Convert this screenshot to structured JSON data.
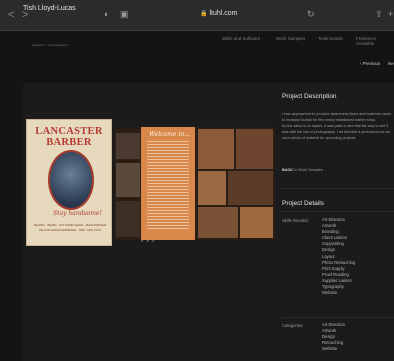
{
  "browser": {
    "back": "<",
    "forward": ">",
    "url": "ltuhl.com",
    "icons": [
      "chevron-left-icon",
      "chevron-right-icon",
      "privacy-icon",
      "tabs-icon",
      "reload-icon",
      "share-icon",
      "plus-icon"
    ]
  },
  "site": {
    "logo": "Tish Lloyd-Lucas",
    "logo_sub": "designer / photographer",
    "nav": [
      "Skills and Software",
      "Work Samples",
      "Testimonials",
      "Freelance Available"
    ]
  },
  "pager": {
    "previous": "‹ Previous",
    "next": "Ne"
  },
  "brochure": {
    "title_line1": "LANCASTER",
    "title_line2": "BARBER",
    "script": "Stay handsome!",
    "tagline_1": "SHAVING · BEARD · HOT TOWEL SHAVE · HEAD MASSAGE",
    "tagline_2": "DELUXE SHAVE EXPERIENCE · TRIM · KIDS CUTS",
    "spread_heading": "Welcome to..."
  },
  "project": {
    "description_heading": "Project Description",
    "description_p1": "I was approached to produce awareness flyers and business cards to increase footfall for this newly established barber shop.",
    "description_p2": "As the salon is so stylish, it was plain to see that the way to sell it was with the use of photography. I art directed a photoshoot as we have plenty of material for upcoming projects.",
    "back_bold": "BACK",
    "back_rest": " to Work Samples",
    "details_heading": "Project Details",
    "skills_label": "Skills Needed:",
    "skills": [
      "Art Direction",
      "Artwork",
      "Branding",
      "Client Liaison",
      "Copywriting",
      "Design",
      "Layout",
      "Photo Retouching",
      "Print Supply",
      "Proof Reading",
      "Supplier Liaison",
      "Typography",
      "Website"
    ],
    "categories_label": "Categories:",
    "categories": [
      "Art Direction",
      "Artwork",
      "Design",
      "Retouching",
      "Website"
    ]
  }
}
